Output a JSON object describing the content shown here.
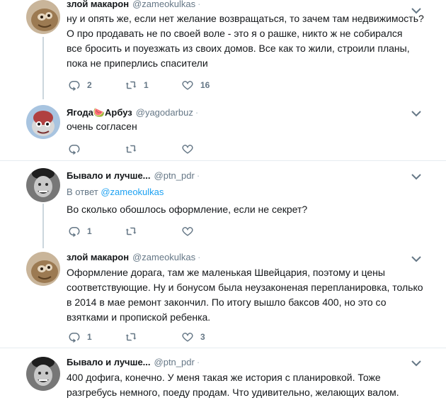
{
  "tweets": [
    {
      "name": "злой макарон",
      "handle": "@zameokulkas",
      "dot": "·",
      "text": [
        "ну и опять же, если нет желание возвращаться, то зачем там недвижимость?",
        "О про продавать не по своей  воле - это я о рашке, никто ж не собирался",
        "все бросить и поуезжать из своих домов. Все как то жили, строили планы,",
        "пока не приперлись спасители"
      ],
      "actions": {
        "replies": "2",
        "retweets": "1",
        "likes": "16"
      }
    },
    {
      "name": "Ягода",
      "name_emoji": "🍉",
      "name2": "Арбуз",
      "handle": "@yagodarbuz",
      "dot": "·",
      "text": [
        "очень согласен"
      ],
      "actions": {
        "replies": "",
        "retweets": "",
        "likes": ""
      }
    },
    {
      "name": "Бывало и лучше...",
      "handle": "@ptn_pdr",
      "dot": "·",
      "reply_prefix": "В ответ",
      "reply_handle": "@zameokulkas",
      "text": [
        "Во сколько обошлось оформление, если не секрет?"
      ],
      "actions": {
        "replies": "1",
        "retweets": "",
        "likes": ""
      }
    },
    {
      "name": "злой макарон",
      "handle": "@zameokulkas",
      "dot": "·",
      "text": [
        "Оформление дорага, там же маленькая Швейцария, поэтому и цены",
        "соответствующие. Ну и бонусом была неузаконеная перепланировка, только",
        "в 2014 в мае ремонт закончил. По итогу вышло баксов 400, но это со",
        "взятками и пропиской ребенка."
      ],
      "actions": {
        "replies": "1",
        "retweets": "",
        "likes": "3"
      }
    },
    {
      "name": "Бывало и лучше...",
      "handle": "@ptn_pdr",
      "dot": "·",
      "text": [
        "400 дофига, конечно. У меня такая же история с планировкой. Тоже",
        "разгребусь немного, поеду продам. Что удивительно, желающих валом."
      ]
    }
  ],
  "colors": {
    "muted": "#657786",
    "link": "#1da1f2",
    "like_active": "#e0245e",
    "divider": "#e6ecf0"
  }
}
